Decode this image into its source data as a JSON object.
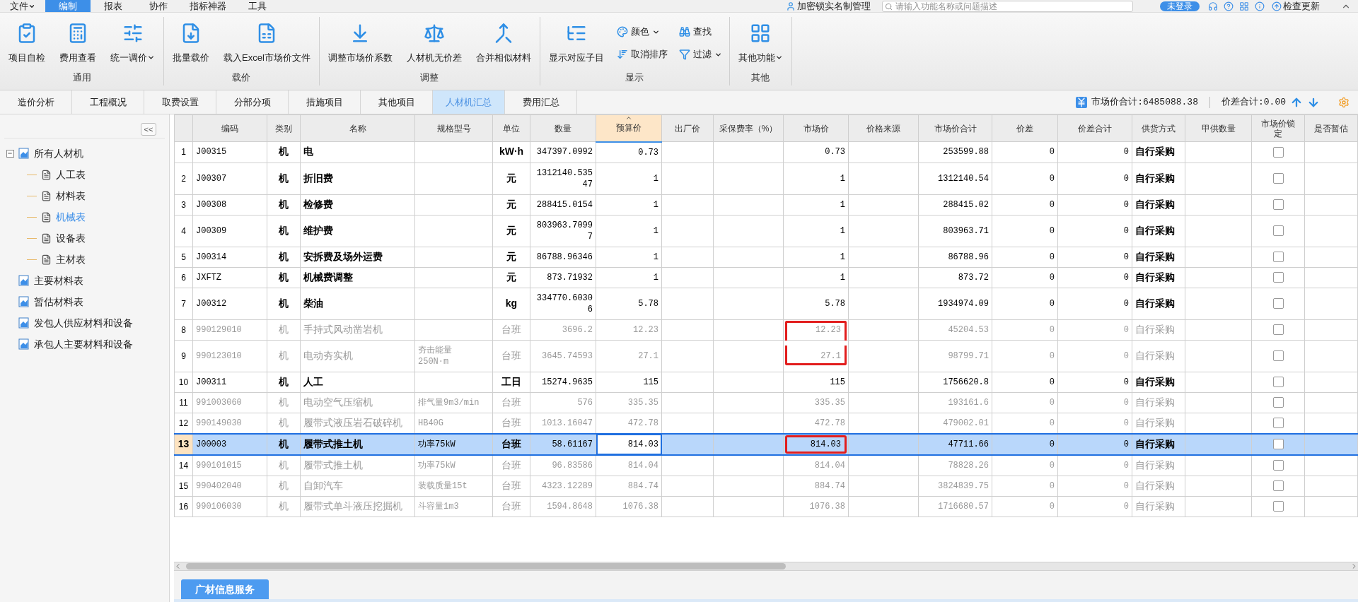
{
  "menu_bar": {
    "items": [
      {
        "label": "文件",
        "dropdown": true,
        "selected": false
      },
      {
        "label": "编制",
        "dropdown": false,
        "selected": true
      },
      {
        "label": "报表",
        "dropdown": false,
        "selected": false
      },
      {
        "label": "协作",
        "dropdown": false,
        "selected": false
      },
      {
        "label": "指标神器",
        "dropdown": false,
        "selected": false
      },
      {
        "label": "工具",
        "dropdown": false,
        "selected": false
      }
    ],
    "lock_link": "加密锁实名制管理",
    "search": {
      "placeholder": "请输入功能名称或问题描述"
    },
    "login_button": "未登录",
    "update_link": "检查更新"
  },
  "ribbon": {
    "groups": [
      {
        "title": "通用",
        "buttons": [
          {
            "label": "项目自检",
            "kind": "large",
            "dropdown": false
          },
          {
            "label": "费用查看",
            "kind": "large",
            "dropdown": false
          },
          {
            "label": "统一调价",
            "kind": "large",
            "dropdown": true
          }
        ]
      },
      {
        "title": "载价",
        "buttons": [
          {
            "label": "批量载价",
            "kind": "large",
            "dropdown": false
          },
          {
            "label": "载入Excel市场价文件",
            "kind": "large",
            "dropdown": false
          }
        ]
      },
      {
        "title": "调整",
        "buttons": [
          {
            "label": "调整市场价系数",
            "kind": "large",
            "dropdown": false
          },
          {
            "label": "人材机无价差",
            "kind": "large",
            "dropdown": false
          },
          {
            "label": "合并相似材料",
            "kind": "large",
            "dropdown": false
          }
        ]
      },
      {
        "title": "显示",
        "buttons": [
          {
            "label": "显示对应子目",
            "kind": "large",
            "dropdown": false
          },
          {
            "label": "颜色",
            "kind": "small",
            "dropdown": true
          },
          {
            "label": "取消排序",
            "kind": "small",
            "dropdown": false
          },
          {
            "label": "查找",
            "kind": "small",
            "dropdown": false
          },
          {
            "label": "过滤",
            "kind": "small",
            "dropdown": true
          }
        ]
      },
      {
        "title": "其他",
        "buttons": [
          {
            "label": "其他功能",
            "kind": "large",
            "dropdown": true
          }
        ]
      }
    ]
  },
  "view_tabs": [
    {
      "label": "造价分析",
      "selected": false
    },
    {
      "label": "工程概况",
      "selected": false
    },
    {
      "label": "取费设置",
      "selected": false
    },
    {
      "label": "分部分项",
      "selected": false
    },
    {
      "label": "措施项目",
      "selected": false
    },
    {
      "label": "其他项目",
      "selected": false
    },
    {
      "label": "人材机汇总",
      "selected": true
    },
    {
      "label": "费用汇总",
      "selected": false
    }
  ],
  "summary": {
    "market_total": "市场价合计:6485088.38",
    "diff_total": "价差合计:0.00"
  },
  "sidebar": {
    "collapse_button": "<<",
    "items": [
      {
        "label": "所有人材机",
        "selected": false,
        "expanded": true,
        "children": [
          {
            "label": "人工表",
            "selected": false
          },
          {
            "label": "材料表",
            "selected": false
          },
          {
            "label": "机械表",
            "selected": true
          },
          {
            "label": "设备表",
            "selected": false
          },
          {
            "label": "主材表",
            "selected": false
          }
        ]
      },
      {
        "label": "主要材料表",
        "selected": false
      },
      {
        "label": "暂估材料表",
        "selected": false
      },
      {
        "label": "发包人供应材料和设备",
        "selected": false
      },
      {
        "label": "承包人主要材料和设备",
        "selected": false
      }
    ]
  },
  "table": {
    "columns": [
      {
        "label": "编码",
        "sorted": false
      },
      {
        "label": "类别",
        "sorted": false
      },
      {
        "label": "名称",
        "sorted": false
      },
      {
        "label": "规格型号",
        "sorted": false
      },
      {
        "label": "单位",
        "sorted": false
      },
      {
        "label": "数量",
        "sorted": false
      },
      {
        "label": "预算价",
        "sorted": true
      },
      {
        "label": "出厂价",
        "sorted": false
      },
      {
        "label": "采保费率（%）",
        "sorted": false
      },
      {
        "label": "市场价",
        "sorted": false
      },
      {
        "label": "价格来源",
        "sorted": false
      },
      {
        "label": "市场价合计",
        "sorted": false
      },
      {
        "label": "价差",
        "sorted": false
      },
      {
        "label": "价差合计",
        "sorted": false
      },
      {
        "label": "供货方式",
        "sorted": false
      },
      {
        "label": "甲供数量",
        "sorted": false
      },
      {
        "label": "市场价锁定",
        "sorted": false
      },
      {
        "label": "是否暂估",
        "sorted": false
      }
    ],
    "rows": [
      {
        "index": "1",
        "code": "J00315",
        "category": "机",
        "name": "电",
        "unit": "kW·h",
        "quantity": "347397.0992",
        "budget_price": "0.73",
        "market_price": "0.73",
        "market_total": "253599.88",
        "price_diff": "0",
        "diff_total": "0",
        "supply": "自行采购",
        "locked": false,
        "dimmed": false,
        "selected": false,
        "flagged": false
      },
      {
        "index": "2",
        "code": "J00307",
        "category": "机",
        "name": "折旧费",
        "unit": "元",
        "quantity": "1312140.53547",
        "budget_price": "1",
        "market_price": "1",
        "market_total": "1312140.54",
        "price_diff": "0",
        "diff_total": "0",
        "supply": "自行采购",
        "locked": false,
        "dimmed": false,
        "selected": false,
        "flagged": false
      },
      {
        "index": "3",
        "code": "J00308",
        "category": "机",
        "name": "检修费",
        "unit": "元",
        "quantity": "288415.0154",
        "budget_price": "1",
        "market_price": "1",
        "market_total": "288415.02",
        "price_diff": "0",
        "diff_total": "0",
        "supply": "自行采购",
        "locked": false,
        "dimmed": false,
        "selected": false,
        "flagged": false
      },
      {
        "index": "4",
        "code": "J00309",
        "category": "机",
        "name": "维护费",
        "unit": "元",
        "quantity": "803963.70997",
        "budget_price": "1",
        "market_price": "1",
        "market_total": "803963.71",
        "price_diff": "0",
        "diff_total": "0",
        "supply": "自行采购",
        "locked": false,
        "dimmed": false,
        "selected": false,
        "flagged": false
      },
      {
        "index": "5",
        "code": "J00314",
        "category": "机",
        "name": "安拆费及场外运费",
        "unit": "元",
        "quantity": "86788.96346",
        "budget_price": "1",
        "market_price": "1",
        "market_total": "86788.96",
        "price_diff": "0",
        "diff_total": "0",
        "supply": "自行采购",
        "locked": false,
        "dimmed": false,
        "selected": false,
        "flagged": false
      },
      {
        "index": "6",
        "code": "JXFTZ",
        "category": "机",
        "name": "机械费调整",
        "unit": "元",
        "quantity": "873.71932",
        "budget_price": "1",
        "market_price": "1",
        "market_total": "873.72",
        "price_diff": "0",
        "diff_total": "0",
        "supply": "自行采购",
        "locked": false,
        "dimmed": false,
        "selected": false,
        "flagged": false
      },
      {
        "index": "7",
        "code": "J00312",
        "category": "机",
        "name": "柴油",
        "unit": "kg",
        "quantity": "334770.60306",
        "budget_price": "5.78",
        "market_price": "5.78",
        "market_total": "1934974.09",
        "price_diff": "0",
        "diff_total": "0",
        "supply": "自行采购",
        "locked": false,
        "dimmed": false,
        "selected": false,
        "flagged": false
      },
      {
        "index": "8",
        "code": "990129010",
        "category": "机",
        "name": "手持式风动凿岩机",
        "unit": "台班",
        "quantity": "3696.2",
        "budget_price": "12.23",
        "market_price": "12.23",
        "market_total": "45204.53",
        "price_diff": "0",
        "diff_total": "0",
        "supply": "自行采购",
        "locked": false,
        "dimmed": true,
        "selected": false,
        "flagged": true
      },
      {
        "index": "9",
        "code": "990123010",
        "category": "机",
        "name": "电动夯实机",
        "spec": "夯击能量\n250N·m",
        "unit": "台班",
        "quantity": "3645.74593",
        "budget_price": "27.1",
        "market_price": "27.1",
        "market_total": "98799.71",
        "price_diff": "0",
        "diff_total": "0",
        "supply": "自行采购",
        "locked": false,
        "dimmed": true,
        "selected": false,
        "flagged": true
      },
      {
        "index": "10",
        "code": "J00311",
        "category": "机",
        "name": "人工",
        "unit": "工日",
        "quantity": "15274.9635",
        "budget_price": "115",
        "market_price": "115",
        "market_total": "1756620.8",
        "price_diff": "0",
        "diff_total": "0",
        "supply": "自行采购",
        "locked": false,
        "dimmed": false,
        "selected": false,
        "flagged": false
      },
      {
        "index": "11",
        "code": "991003060",
        "category": "机",
        "name": "电动空气压缩机",
        "spec": "排气量9m3/min",
        "unit": "台班",
        "quantity": "576",
        "budget_price": "335.35",
        "market_price": "335.35",
        "market_total": "193161.6",
        "price_diff": "0",
        "diff_total": "0",
        "supply": "自行采购",
        "locked": false,
        "dimmed": true,
        "selected": false,
        "flagged": false
      },
      {
        "index": "12",
        "code": "990149030",
        "category": "机",
        "name": "履带式液压岩石破碎机",
        "spec": "HB40G",
        "unit": "台班",
        "quantity": "1013.16047",
        "budget_price": "472.78",
        "market_price": "472.78",
        "market_total": "479002.01",
        "price_diff": "0",
        "diff_total": "0",
        "supply": "自行采购",
        "locked": false,
        "dimmed": true,
        "selected": false,
        "flagged": false
      },
      {
        "index": "13",
        "code": "J00003",
        "category": "机",
        "name": "履带式推土机",
        "spec": "功率75kW",
        "unit": "台班",
        "quantity": "58.61167",
        "budget_price": "814.03",
        "market_price": "814.03",
        "market_total": "47711.66",
        "price_diff": "0",
        "diff_total": "0",
        "supply": "自行采购",
        "locked": false,
        "dimmed": false,
        "selected": true,
        "flagged": true
      },
      {
        "index": "14",
        "code": "990101015",
        "category": "机",
        "name": "履带式推土机",
        "spec": "功率75kW",
        "unit": "台班",
        "quantity": "96.83586",
        "budget_price": "814.04",
        "market_price": "814.04",
        "market_total": "78828.26",
        "price_diff": "0",
        "diff_total": "0",
        "supply": "自行采购",
        "locked": false,
        "dimmed": true,
        "selected": false,
        "flagged": false
      },
      {
        "index": "15",
        "code": "990402040",
        "category": "机",
        "name": "自卸汽车",
        "spec": "装载质量15t",
        "unit": "台班",
        "quantity": "4323.12289",
        "budget_price": "884.74",
        "market_price": "884.74",
        "market_total": "3824839.75",
        "price_diff": "0",
        "diff_total": "0",
        "supply": "自行采购",
        "locked": false,
        "dimmed": true,
        "selected": false,
        "flagged": false
      },
      {
        "index": "16",
        "code": "990106030",
        "category": "机",
        "name": "履带式单斗液压挖掘机",
        "spec": "斗容量1m3",
        "unit": "台班",
        "quantity": "1594.8648",
        "budget_price": "1076.38",
        "market_price": "1076.38",
        "market_total": "1716680.57",
        "price_diff": "0",
        "diff_total": "0",
        "supply": "自行采购",
        "locked": false,
        "dimmed": true,
        "selected": false,
        "flagged": false
      }
    ]
  },
  "bottom_tabs": [
    {
      "label": "广材信息服务",
      "selected": true
    }
  ]
}
